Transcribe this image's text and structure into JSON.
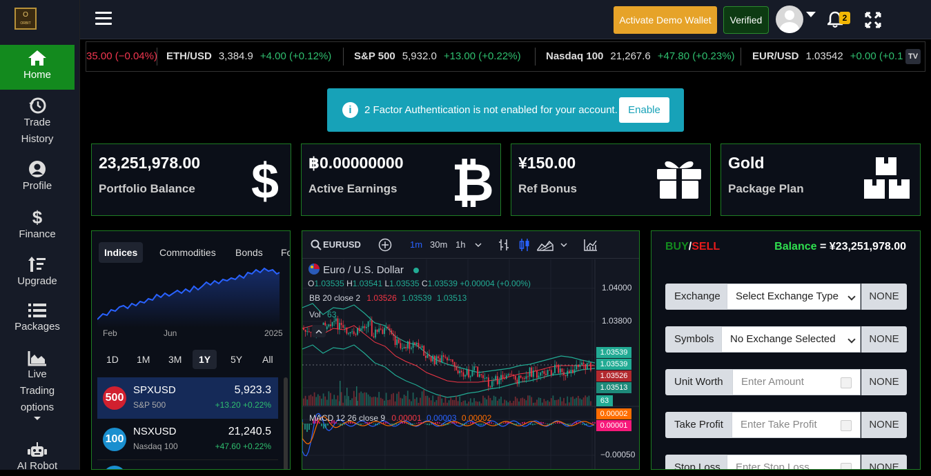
{
  "brand": {
    "logo_letter": "O",
    "logo_sub": "ORBIT"
  },
  "sidebar": {
    "items": [
      {
        "label": "Home",
        "icon": "home-icon"
      },
      {
        "label": "Trade History",
        "icon": "history-icon"
      },
      {
        "label": "Profile",
        "icon": "user-circle-icon"
      },
      {
        "label": "Finance",
        "icon": "dollar-icon"
      },
      {
        "label": "Upgrade",
        "icon": "sort-up-icon"
      },
      {
        "label": "Packages",
        "icon": "list-icon"
      },
      {
        "label": "Live Trading options",
        "icon": "area-chart-icon"
      },
      {
        "label": "AI Robot",
        "icon": "robot-icon"
      }
    ]
  },
  "topbar": {
    "demo_button": "Activate Demo Wallet",
    "verified_button": "Verified",
    "notification_count": "2"
  },
  "ticker": [
    {
      "symbol": "",
      "price": "",
      "change": "35.00 (−0.04%)",
      "dir": "dn"
    },
    {
      "symbol": "ETH/USD",
      "price": "3,384.9",
      "change": "+4.00 (+0.12%)",
      "dir": "up"
    },
    {
      "symbol": "S&P 500",
      "price": "5,932.0",
      "change": "+13.00 (+0.22%)",
      "dir": "up"
    },
    {
      "symbol": "Nasdaq 100",
      "price": "21,267.6",
      "change": "+47.80 (+0.23%)",
      "dir": "up"
    },
    {
      "symbol": "EUR/USD",
      "price": "1.03542",
      "change": "+0.00 (+0.1",
      "dir": "up"
    }
  ],
  "alert": {
    "text": "2 Factor Authentication is not enabled for your account.",
    "button": "Enable"
  },
  "cards": [
    {
      "value": "23,251,978.00",
      "label": "Portfolio Balance",
      "icon": "dollar-icon"
    },
    {
      "value": "฿0.00000000",
      "label": "Active Earnings",
      "icon": "bitcoin-icon"
    },
    {
      "value": "¥150.00",
      "label": "Ref Bonus",
      "icon": "gift-icon"
    },
    {
      "value": "Gold",
      "label": "Package Plan",
      "icon": "boxes-icon"
    }
  ],
  "market": {
    "tabs": [
      "Indices",
      "Commodities",
      "Bonds",
      "Fo"
    ],
    "axis": [
      "Feb",
      "Jun",
      "2025"
    ],
    "ranges": [
      "1D",
      "1M",
      "3M",
      "1Y",
      "5Y",
      "All"
    ],
    "rows": [
      {
        "badge": "500",
        "symbol": "SPXUSD",
        "name": "S&P 500",
        "price": "5,923.3",
        "change": "+13.20  +0.22%"
      },
      {
        "badge": "100",
        "symbol": "NSXUSD",
        "name": "Nasdaq 100",
        "price": "21,240.5",
        "change": "+47.60  +0.22%"
      }
    ]
  },
  "tvchart": {
    "symbol": "EURUSD",
    "intervals": [
      "1m",
      "30m",
      "1h"
    ],
    "title": "Euro / U.S. Dollar",
    "ohlc": {
      "o": "1.03535",
      "h": "1.03541",
      "l": "1.03535",
      "c": "1.03539",
      "chg": "+0.00004 (+0.00%)"
    },
    "bb": {
      "label": "BB 20 close 2",
      "v1": "1.03526",
      "v2": "1.03539",
      "v3": "1.03513"
    },
    "vol": {
      "label": "Vol",
      "value": "63"
    },
    "macd": {
      "label": "MACD 12 26 close 9",
      "v1": "0.00001",
      "v2": "0.00003",
      "v3": "0.00002"
    },
    "price_axis": [
      "1.04000",
      "1.03800"
    ],
    "tags": [
      "1.03539",
      "1.03539",
      "1.03526",
      "1.03513",
      "63"
    ],
    "macd_tags": [
      "0.00002",
      "0.00001"
    ],
    "macd_axis": "−0.00050"
  },
  "trade": {
    "buy": "BUY",
    "slash": "/",
    "sell": "SELL",
    "balance_label": "Balance",
    "balance_value": "= ¥23,251,978.00",
    "fields": [
      {
        "label": "Exchange",
        "value": "Select Exchange Type",
        "type": "select",
        "unit": "NONE"
      },
      {
        "label": "Symbols",
        "value": "No Exchange Selected",
        "type": "select",
        "unit": "NONE"
      },
      {
        "label": "Unit Worth",
        "value": "Enter Amount",
        "type": "number",
        "unit": "NONE"
      },
      {
        "label": "Take Profit",
        "value": "Enter Take Profit",
        "type": "number",
        "unit": "NONE"
      },
      {
        "label": "Stop Loss",
        "value": "Enter Stop Loss",
        "type": "number",
        "unit": "NONE"
      }
    ]
  },
  "colors": {
    "accent_green": "#138a1e",
    "warning": "#e6a329",
    "info": "#17a2b8",
    "up": "#2fbf6f",
    "down": "#f0364f"
  }
}
